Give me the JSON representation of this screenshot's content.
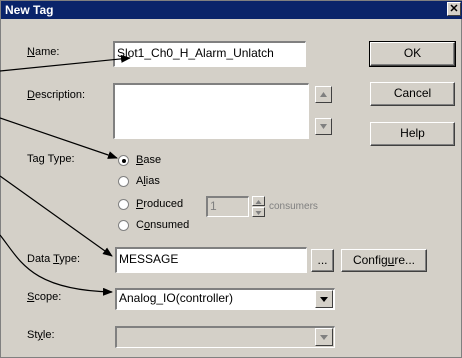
{
  "window": {
    "title": "New Tag",
    "close_glyph": "✕"
  },
  "labels": {
    "name": "Name:",
    "description": "Description:",
    "tag_type": "Tag Type:",
    "data_type": "Data Type:",
    "scope": "Scope:",
    "style": "Style:"
  },
  "fields": {
    "name_value": "Slot1_Ch0_H_Alarm_Unlatch",
    "description_value": "",
    "data_type_value": "MESSAGE",
    "scope_value": "Analog_IO(controller)",
    "style_value": "",
    "consumers_value": "1"
  },
  "radios": {
    "base": "Base",
    "alias": "Alias",
    "produced": "Produced",
    "consumed": "Consumed",
    "selected": "Base"
  },
  "consumers_label": "consumers",
  "buttons": {
    "ok": "OK",
    "cancel": "Cancel",
    "help": "Help",
    "browse": "...",
    "configure": "Configure..."
  },
  "icons": {
    "scroll_up": "scroll-up-icon",
    "scroll_down": "scroll-down-icon",
    "dropdown": "chevron-down-icon",
    "spin_up": "spin-up-icon",
    "spin_down": "spin-down-icon"
  },
  "colors": {
    "titlebar": "#0a246a",
    "dialog": "#d4d0c8"
  }
}
